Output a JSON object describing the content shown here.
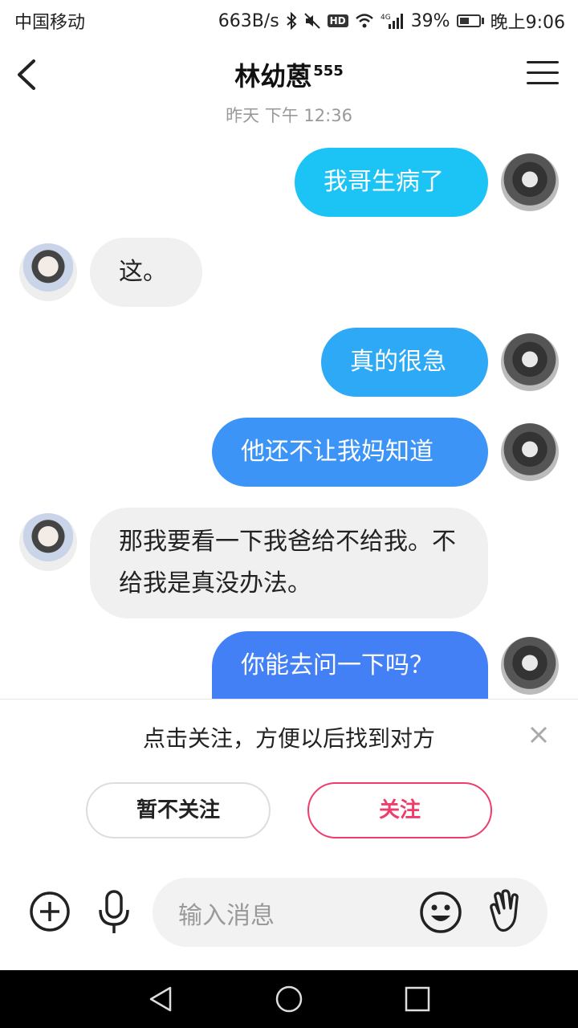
{
  "status_bar": {
    "carrier": "中国移动",
    "speed": "663B/s",
    "hd": "HD",
    "network": "4G",
    "battery": "39%",
    "time": "晚上9:06"
  },
  "header": {
    "title": "林幼蒽",
    "title_suffix": "555"
  },
  "timestamp": "昨天 下午 12:36",
  "messages": [
    {
      "from": "me",
      "text": "我哥生病了"
    },
    {
      "from": "them",
      "text": "这。"
    },
    {
      "from": "me",
      "text": "真的很急"
    },
    {
      "from": "me",
      "text": "他还不让我妈知道"
    },
    {
      "from": "them",
      "text": "那我要看一下我爸给不给我。不给我是真没办法。"
    },
    {
      "from": "me",
      "text": "你能去问一下吗？"
    }
  ],
  "follow_panel": {
    "prompt": "点击关注，方便以后找到对方",
    "later_label": "暂不关注",
    "follow_label": "关注"
  },
  "input": {
    "placeholder": "输入消息"
  },
  "colors": {
    "bubble_sent_1": "#1cc3f5",
    "bubble_sent_2": "#2ea9f5",
    "bubble_sent_3": "#3b94f6",
    "bubble_sent_4": "#4480f5",
    "bubble_recv": "#f0f0f0",
    "follow_accent": "#f03c6a"
  },
  "icons": [
    "back-arrow-icon",
    "menu-icon",
    "close-icon",
    "plus-icon",
    "microphone-icon",
    "emoji-icon",
    "wave-hand-icon",
    "nav-back-icon",
    "nav-home-icon",
    "nav-recents-icon"
  ]
}
